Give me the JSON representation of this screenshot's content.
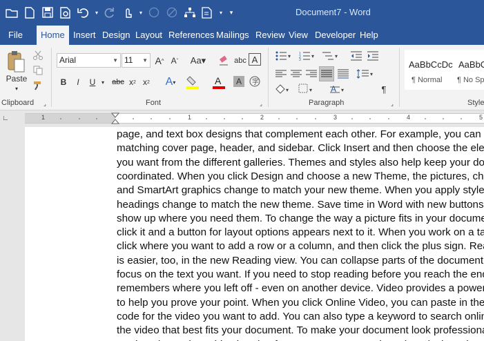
{
  "window": {
    "title": "Document7 - Word"
  },
  "tabs": [
    "File",
    "Home",
    "Insert",
    "Design",
    "Layout",
    "References",
    "Mailings",
    "Review",
    "View",
    "Developer",
    "Help"
  ],
  "clipboard": {
    "paste_label": "Paste",
    "group_label": "Clipboard"
  },
  "font": {
    "name": "Arial",
    "size": "11",
    "group_label": "Font"
  },
  "paragraph": {
    "group_label": "Paragraph"
  },
  "styles": {
    "group_label": "Styles",
    "items": [
      {
        "preview": "AaBbCcDc",
        "name": "¶ Normal"
      },
      {
        "preview": "AaBbCcDc",
        "name": "¶ No Spac..."
      }
    ]
  },
  "ruler": {
    "numbers": [
      "1",
      "1",
      "2",
      "3",
      "4",
      "5"
    ]
  },
  "document": {
    "lines": [
      "page, and text box designs that complement each other. For example, you can add a",
      "matching cover page, header, and sidebar. Click Insert and then choose the elements",
      "you want from the different galleries. Themes and styles also help keep your document",
      "coordinated. When you click Design and choose a new Theme, the pictures, charts,",
      "and SmartArt graphics change to match your new theme. When you apply styles, your",
      "headings change to match the new theme. Save time in Word with new buttons that",
      "show up where you need them. To change the way a picture fits in your document,",
      "click it and a button for layout options appears next to it. When you work on a table,",
      "click where you want to add a row or a column, and then click the plus sign. Reading",
      "is easier, too, in the new Reading view. You can collapse parts of the document and",
      "focus on the text you want. If you need to stop reading before you reach the end, Word",
      "remembers where you left off - even on another device. Video provides a powerful way",
      "to help you prove your point. When you click Online Video, you can paste in the embed",
      "code for the video you want to add. You can also type a keyword to search online for",
      "the video that best fits your document. To make your document look professionally",
      "produced, Word provides header, footer, cover page, and text box designs that"
    ]
  }
}
